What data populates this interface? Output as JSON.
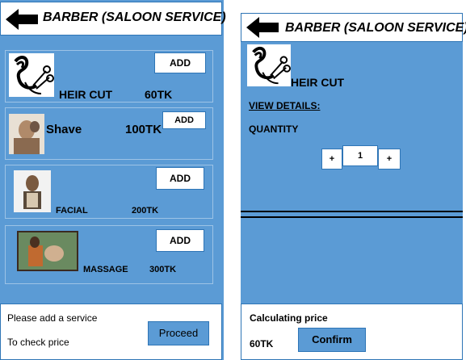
{
  "left": {
    "title": "BARBER (SALOON SERVICE)",
    "services": [
      {
        "name": "HEIR CUT",
        "price": "60TK",
        "add_label": "ADD",
        "icon": "haircut-icon"
      },
      {
        "name": "Shave",
        "price": "100TK",
        "add_label": "ADD",
        "icon": "shave-photo"
      },
      {
        "name": "FACIAL",
        "price": "200TK",
        "add_label": "ADD",
        "icon": "facial-photo"
      },
      {
        "name": "MASSAGE",
        "price": "300TK",
        "add_label": "ADD",
        "icon": "massage-photo"
      }
    ],
    "footer": {
      "line1": "Please add a service",
      "line2": "To check price",
      "proceed_label": "Proceed"
    }
  },
  "right": {
    "title": "BARBER (SALOON SERVICE)",
    "service_name": "HEIR CUT",
    "view_details": "VIEW DETAILS:",
    "quantity_label": "QUANTITY",
    "minus_label": "+",
    "quantity_value": "1",
    "plus_label": "+",
    "footer": {
      "calc_label": "Calculating price",
      "price": "60TK",
      "confirm_label": "Confirm"
    }
  },
  "colors": {
    "panel": "#5b9bd5",
    "border": "#2e75b6",
    "header_bg": "#ffffff"
  }
}
